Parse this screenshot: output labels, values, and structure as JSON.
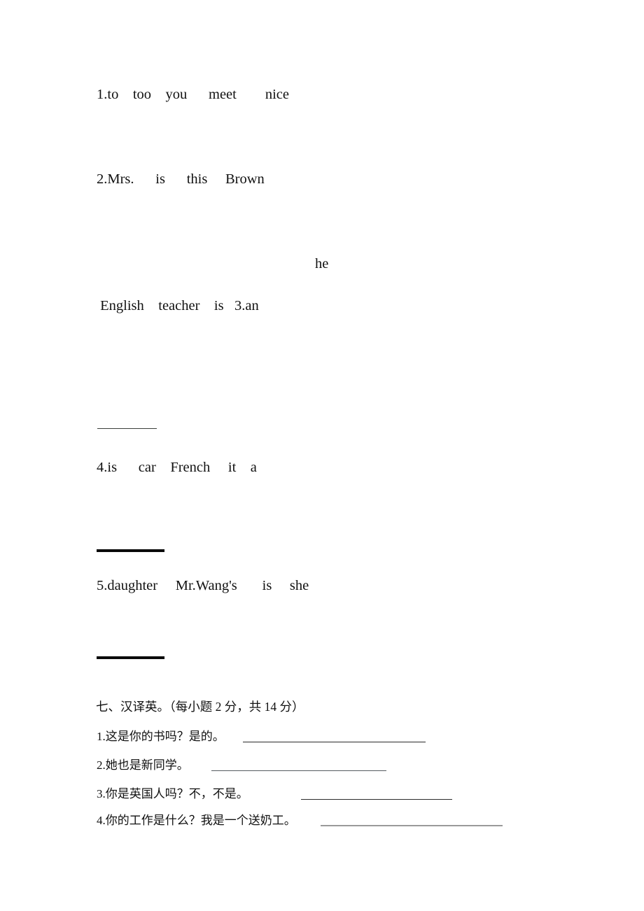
{
  "document": {
    "page_background": "#ffffff",
    "text_color": "#111111"
  },
  "scramble_section": {
    "items": [
      {
        "id": 1,
        "text": "1.to    too    you      meet        nice"
      },
      {
        "id": 2,
        "text": "2.Mrs.      is      this     Brown"
      },
      {
        "id": 3,
        "floating_word": "he",
        "text": " English    teacher    is   3.an"
      },
      {
        "id": 4,
        "text": "4.is      car    French     it    a"
      },
      {
        "id": 5,
        "text": "5.daughter     Mr.Wang's       is     she"
      }
    ]
  },
  "translation_section": {
    "heading": "七、汉译英。（每小题 2 分，共 14 分）",
    "items": [
      {
        "id": 1,
        "text": "1.这是你的书吗？是的。"
      },
      {
        "id": 2,
        "text": "2.她也是新同学。"
      },
      {
        "id": 3,
        "text": "3.你是英国人吗？不，不是。"
      },
      {
        "id": 4,
        "text": "4.你的工作是什么？我是一个送奶工。"
      }
    ]
  }
}
